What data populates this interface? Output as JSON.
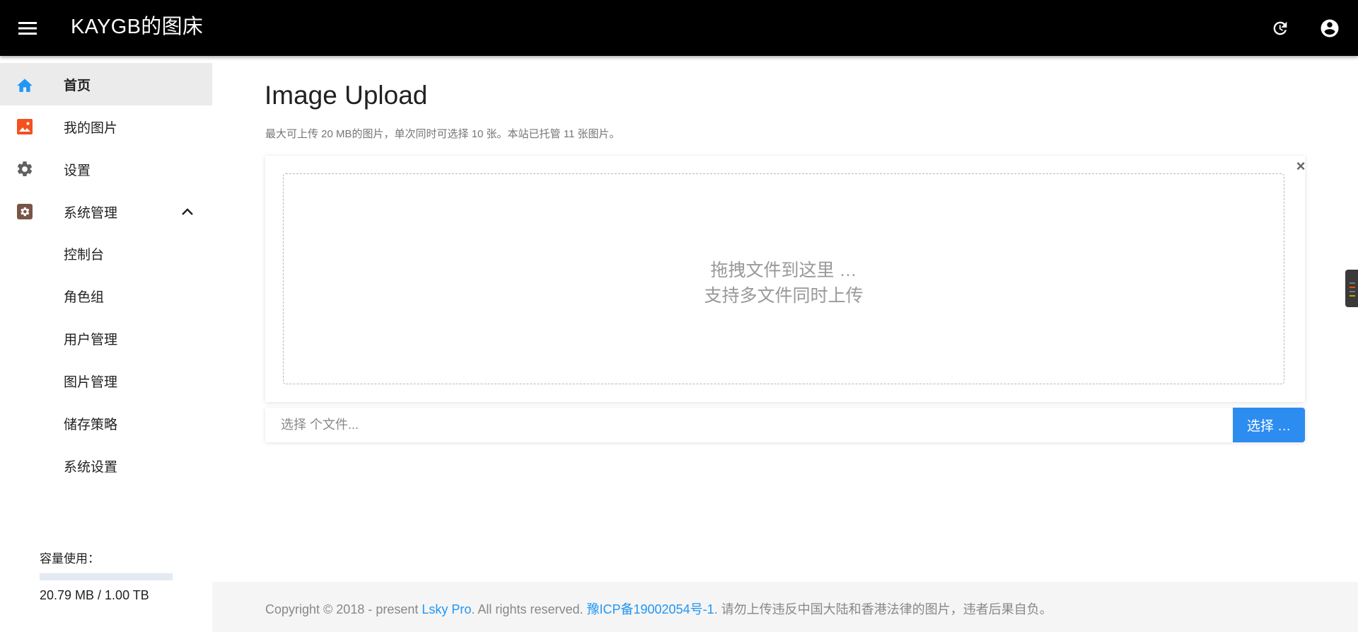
{
  "header": {
    "title": "KAYGB的图床",
    "menu_icon": "menu-icon",
    "refresh_icon": "refresh-icon",
    "account_icon": "account-circle-icon"
  },
  "sidebar": {
    "items": [
      {
        "label": "首页",
        "icon": "home-icon",
        "color": "#2196f3",
        "active": true
      },
      {
        "label": "我的图片",
        "icon": "image-icon",
        "color": "#f4511e"
      },
      {
        "label": "设置",
        "icon": "gear-icon",
        "color": "#616161"
      },
      {
        "label": "系统管理",
        "icon": "admin-settings-icon",
        "color": "#795548",
        "expanded": true
      }
    ],
    "sub_items": [
      {
        "label": "控制台"
      },
      {
        "label": "角色组"
      },
      {
        "label": "用户管理"
      },
      {
        "label": "图片管理"
      },
      {
        "label": "储存策略"
      },
      {
        "label": "系统设置"
      }
    ],
    "storage": {
      "label": "容量使用：",
      "value": "20.79 MB / 1.00 TB",
      "fraction": 2e-05
    }
  },
  "main": {
    "title": "Image Upload",
    "subtitle": "最大可上传 20 MB的图片，单次同时可选择 10 张。本站已托管 11 张图片。",
    "dropzone": {
      "line1": "拖拽文件到这里 …",
      "line2": "支持多文件同时上传"
    },
    "close_label": "×",
    "file_input": {
      "placeholder": "选择 个文件..."
    },
    "select_button": "选择 …"
  },
  "footer": {
    "prefix": "Copyright © 2018 - present ",
    "brand_link": "Lsky Pro",
    "middle": ". All rights reserved. ",
    "icp_link": "豫ICP备19002054号-1",
    "suffix": ". 请勿上传违反中国大陆和香港法律的图片，违者后果自负。"
  },
  "colors": {
    "topbar": "#000000",
    "accent": "#2196f3",
    "button": "#2c8cf0"
  }
}
